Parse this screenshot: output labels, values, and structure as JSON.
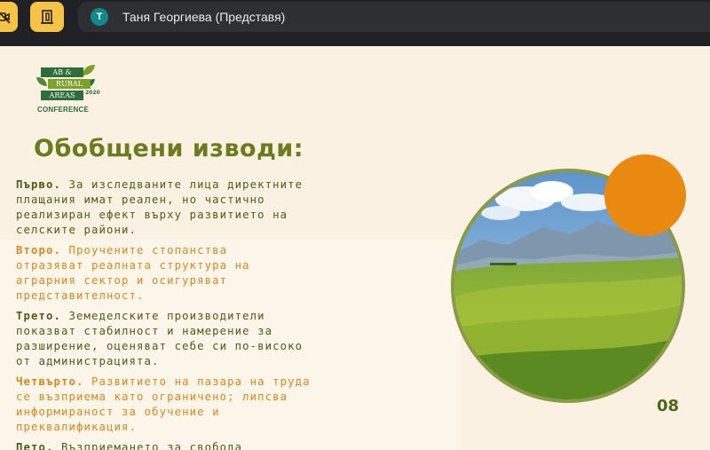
{
  "meeting": {
    "presenter_initial": "Т",
    "presenter_name": "Таня Георгиева (Представя)",
    "icons": [
      "camera-off-icon",
      "door-exit-icon"
    ],
    "accent": "#f6c344",
    "avatar_color": "#12888b"
  },
  "slide": {
    "logo": {
      "line1": "AB &",
      "line2": "RURAL",
      "line3": "AREAS",
      "year": "2020",
      "conference": "CONFERENCE"
    },
    "title": "Обобщени изводи:",
    "points": [
      {
        "key": "Първо.",
        "text": " За изследваните лица директните\nплащания имат реален, но частично\nреализиран ефект върху развитието на\nселските райони.",
        "color": "green"
      },
      {
        "key": "Второ.",
        "text": " Проучените стопанства\nотразяват реалната структура на\nаграрния сектор и осигуряват\nпредставителност.",
        "color": "orange"
      },
      {
        "key": "Трето.",
        "text": " Земеделските производители\nпоказват стабилност и намерение за\nразширение, оценяват себе си по-високо\nот администрацията.",
        "color": "green"
      },
      {
        "key": "Четвърто.",
        "text": " Развитието на пазара на труда\nсе възприема като ограничено; липсва\nинформираност за обучение и\nпреквалификация.",
        "color": "orange"
      },
      {
        "key": "Пето.",
        "text": " Възприемането за свобода",
        "color": "green"
      }
    ],
    "page_number": "08",
    "colors": {
      "title": "#6b7c1f",
      "green_text": "#4e5d17",
      "orange_text": "#e0861b",
      "orange_circle": "#e9890f",
      "background": "#fbf1e3"
    }
  }
}
